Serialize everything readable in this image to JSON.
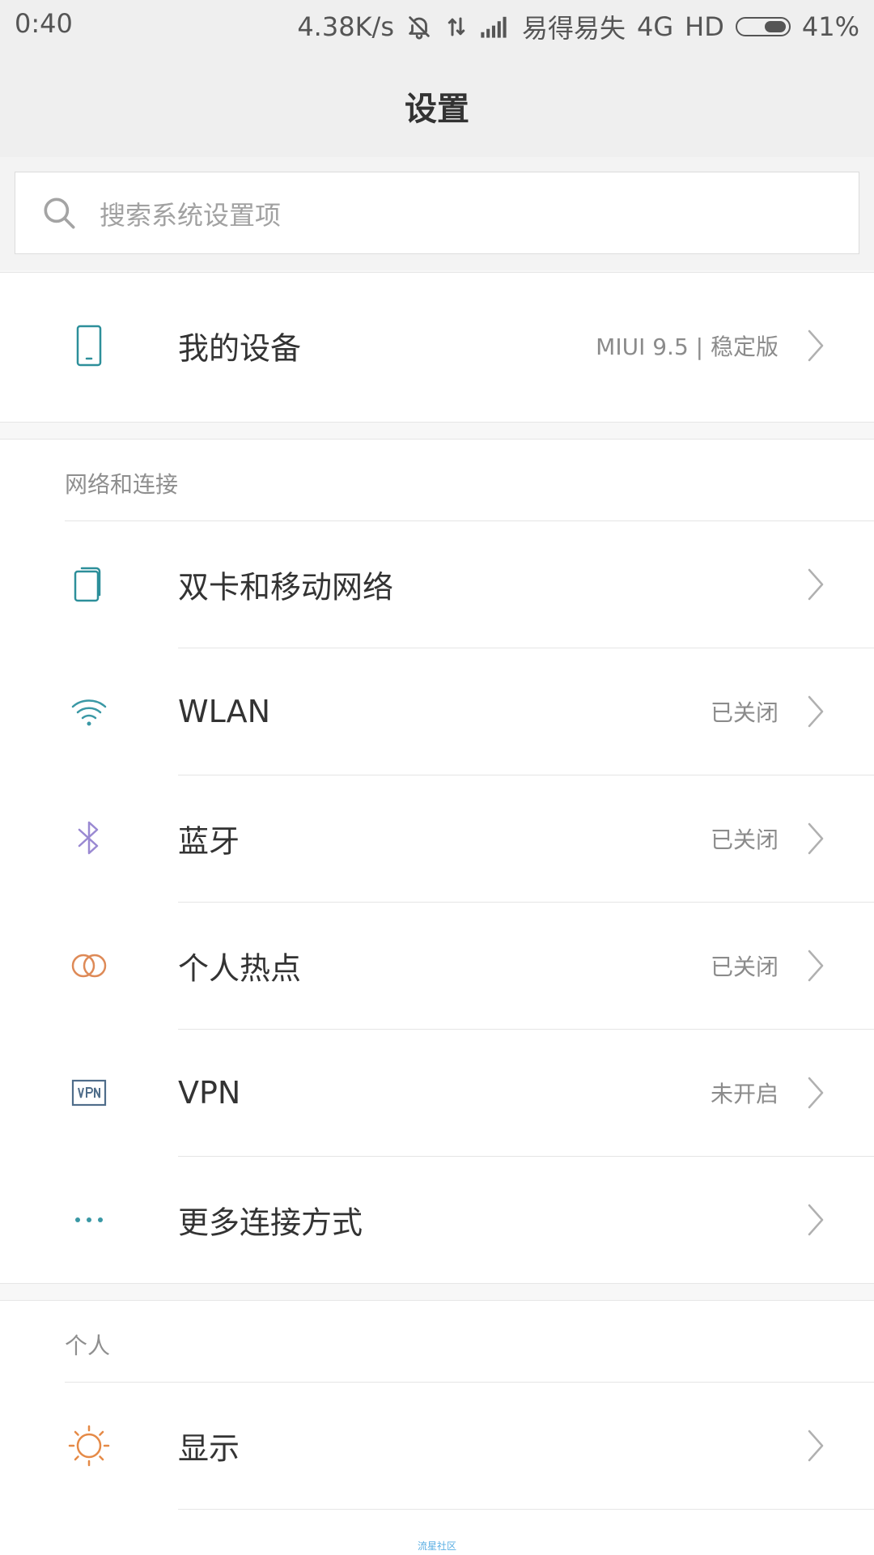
{
  "status_bar": {
    "time": "0:40",
    "speed": "4.38K/s",
    "carrier": "易得易失",
    "network": "4G",
    "hd": "HD",
    "battery": "41%"
  },
  "header": {
    "title": "设置"
  },
  "search": {
    "placeholder": "搜索系统设置项"
  },
  "device": {
    "label": "我的设备",
    "value": "MIUI 9.5 | 稳定版"
  },
  "sections": [
    {
      "title": "网络和连接",
      "items": [
        {
          "label": "双卡和移动网络",
          "value": ""
        },
        {
          "label": "WLAN",
          "value": "已关闭"
        },
        {
          "label": "蓝牙",
          "value": "已关闭"
        },
        {
          "label": "个人热点",
          "value": "已关闭"
        },
        {
          "label": "VPN",
          "value": "未开启"
        },
        {
          "label": "更多连接方式",
          "value": ""
        }
      ]
    },
    {
      "title": "个人",
      "items": [
        {
          "label": "显示",
          "value": ""
        }
      ]
    }
  ],
  "watermark": "流星社区",
  "colors": {
    "accent": "#2d8f9a",
    "wifi": "#3a98a5",
    "bluetooth": "#9a89d2",
    "hotspot": "#de8a57",
    "vpn": "#4f6d8a",
    "display": "#e58a47"
  }
}
